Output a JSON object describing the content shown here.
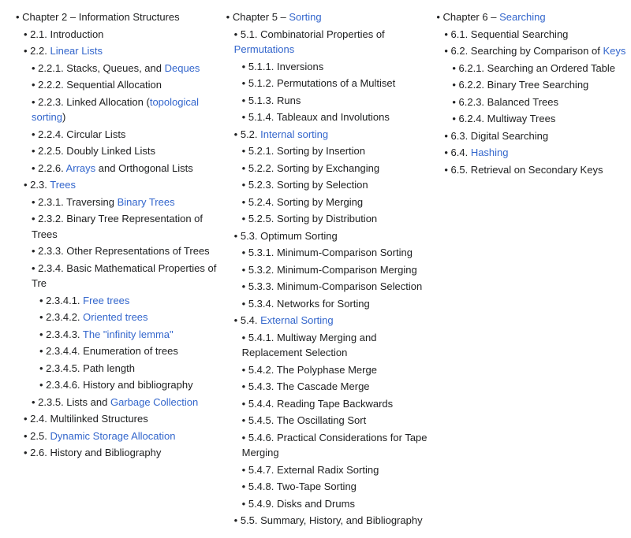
{
  "columns": [
    {
      "id": "col1",
      "chapter": {
        "prefix": "Chapter 2 –",
        "title": "Information Structures",
        "link": false
      },
      "items": [
        {
          "level": 1,
          "text": "2.1. Introduction",
          "link": false,
          "linkText": null
        },
        {
          "level": 1,
          "text": "2.2.",
          "link": true,
          "linkText": "Linear Lists",
          "suffix": ""
        },
        {
          "level": 2,
          "text": "2.2.1.",
          "link": false,
          "rest": " Stacks, Queues, and ",
          "link2": "Deques",
          "suffix": ""
        },
        {
          "level": 2,
          "text": "2.2.2. Sequential Allocation",
          "link": false,
          "linkText": null
        },
        {
          "level": 2,
          "text": "2.2.3. Linked Allocation (",
          "link": true,
          "linkText": "topological sorting",
          "suffix": ")"
        },
        {
          "level": 2,
          "text": "2.2.4. Circular Lists",
          "link": false
        },
        {
          "level": 2,
          "text": "2.2.5. Doubly Linked Lists",
          "link": false
        },
        {
          "level": 2,
          "text": "2.2.6.",
          "link": false,
          "rest": " ",
          "link2": "Arrays",
          "link2text": "Arrays",
          "suffix": " and Orthogonal Lists"
        },
        {
          "level": 1,
          "text": "2.3.",
          "link": true,
          "linkText": "Trees",
          "suffix": ""
        },
        {
          "level": 2,
          "text": "2.3.1. Traversing ",
          "link": true,
          "linkText": "Binary Trees",
          "suffix": ""
        },
        {
          "level": 2,
          "text": "2.3.2. Binary Tree Representation of Trees",
          "link": false
        },
        {
          "level": 2,
          "text": "2.3.3. Other Representations of Trees",
          "link": false
        },
        {
          "level": 2,
          "text": "2.3.4. Basic Mathematical Properties of Tre",
          "link": false
        },
        {
          "level": 3,
          "text": "2.3.4.1.",
          "link": true,
          "linkText": "Free trees",
          "suffix": ""
        },
        {
          "level": 3,
          "text": "2.3.4.2.",
          "link": true,
          "linkText": "Oriented trees",
          "suffix": ""
        },
        {
          "level": 3,
          "text": "2.3.4.3.",
          "link": true,
          "linkText": "The \"infinity lemma\"",
          "suffix": ""
        },
        {
          "level": 3,
          "text": "2.3.4.4. Enumeration of trees",
          "link": false
        },
        {
          "level": 3,
          "text": "2.3.4.5. Path length",
          "link": false
        },
        {
          "level": 3,
          "text": "2.3.4.6. History and bibliography",
          "link": false
        },
        {
          "level": 2,
          "text": "2.3.5. Lists and ",
          "link": true,
          "linkText": "Garbage Collection",
          "suffix": ""
        },
        {
          "level": 1,
          "text": "2.4. Multilinked Structures",
          "link": false
        },
        {
          "level": 1,
          "text": "2.5.",
          "link": true,
          "linkText": "Dynamic Storage Allocation",
          "suffix": ""
        },
        {
          "level": 1,
          "text": "2.6. History and Bibliography",
          "link": false
        }
      ]
    },
    {
      "id": "col2",
      "chapter": {
        "prefix": "Chapter 5 –",
        "title": "Sorting",
        "link": true
      },
      "items": [
        {
          "level": 1,
          "text": "5.1. Combinatorial Properties of ",
          "link": true,
          "linkText": "Permutations",
          "suffix": ""
        },
        {
          "level": 2,
          "text": "5.1.1. Inversions",
          "link": false
        },
        {
          "level": 2,
          "text": "5.1.2. Permutations of a Multiset",
          "link": false
        },
        {
          "level": 2,
          "text": "5.1.3. Runs",
          "link": false
        },
        {
          "level": 2,
          "text": "5.1.4. Tableaux and Involutions",
          "link": false
        },
        {
          "level": 1,
          "text": "5.2.",
          "link": true,
          "linkText": "Internal sorting",
          "suffix": ""
        },
        {
          "level": 2,
          "text": "5.2.1. Sorting by Insertion",
          "link": false
        },
        {
          "level": 2,
          "text": "5.2.2. Sorting by Exchanging",
          "link": false
        },
        {
          "level": 2,
          "text": "5.2.3. Sorting by Selection",
          "link": false
        },
        {
          "level": 2,
          "text": "5.2.4. Sorting by Merging",
          "link": false
        },
        {
          "level": 2,
          "text": "5.2.5. Sorting by Distribution",
          "link": false
        },
        {
          "level": 1,
          "text": "5.3. Optimum Sorting",
          "link": false
        },
        {
          "level": 2,
          "text": "5.3.1. Minimum-Comparison Sorting",
          "link": false
        },
        {
          "level": 2,
          "text": "5.3.2. Minimum-Comparison Merging",
          "link": false
        },
        {
          "level": 2,
          "text": "5.3.3. Minimum-Comparison Selection",
          "link": false
        },
        {
          "level": 2,
          "text": "5.3.4. Networks for Sorting",
          "link": false
        },
        {
          "level": 1,
          "text": "5.4.",
          "link": true,
          "linkText": "External Sorting",
          "suffix": ""
        },
        {
          "level": 2,
          "text": "5.4.1. Multiway Merging and Replacement Selection",
          "link": false
        },
        {
          "level": 2,
          "text": "5.4.2. The Polyphase Merge",
          "link": false
        },
        {
          "level": 2,
          "text": "5.4.3. The Cascade Merge",
          "link": false
        },
        {
          "level": 2,
          "text": "5.4.4. Reading Tape Backwards",
          "link": false
        },
        {
          "level": 2,
          "text": "5.4.5. The Oscillating Sort",
          "link": false
        },
        {
          "level": 2,
          "text": "5.4.6. Practical Considerations for Tape Merging",
          "link": false
        },
        {
          "level": 2,
          "text": "5.4.7. External Radix Sorting",
          "link": false
        },
        {
          "level": 2,
          "text": "5.4.8. Two-Tape Sorting",
          "link": false
        },
        {
          "level": 2,
          "text": "5.4.9. Disks and Drums",
          "link": false
        },
        {
          "level": 1,
          "text": "5.5. Summary, History, and Bibliography",
          "link": false
        }
      ]
    },
    {
      "id": "col3",
      "chapter": {
        "prefix": "Chapter 6 –",
        "title": "Searching",
        "link": true
      },
      "items": [
        {
          "level": 1,
          "text": "6.1. Sequential Searching",
          "link": false
        },
        {
          "level": 1,
          "text": "6.2. Searching by Comparison of ",
          "link": true,
          "linkText": "Keys",
          "suffix": ""
        },
        {
          "level": 2,
          "text": "6.2.1. Searching an Ordered Table",
          "link": false
        },
        {
          "level": 2,
          "text": "6.2.2. Binary Tree Searching",
          "link": false
        },
        {
          "level": 2,
          "text": "6.2.3. Balanced Trees",
          "link": false
        },
        {
          "level": 2,
          "text": "6.2.4. Multiway Trees",
          "link": false
        },
        {
          "level": 1,
          "text": "6.3. Digital Searching",
          "link": false
        },
        {
          "level": 1,
          "text": "6.4.",
          "link": true,
          "linkText": "Hashing",
          "suffix": ""
        },
        {
          "level": 1,
          "text": "6.5. Retrieval on Secondary Keys",
          "link": false
        }
      ]
    }
  ]
}
